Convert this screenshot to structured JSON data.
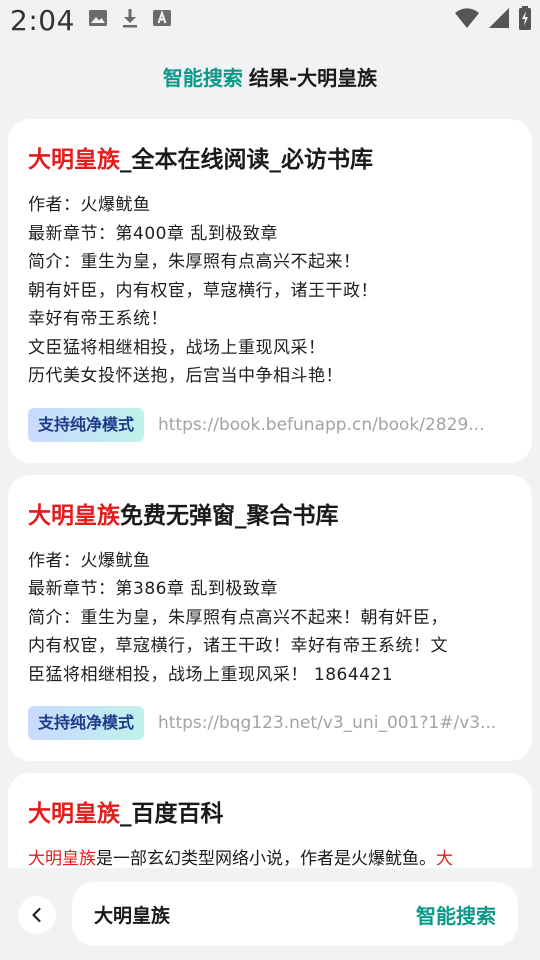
{
  "status_bar": {
    "time": "2:04",
    "left_icons": [
      "image-icon",
      "download-icon",
      "font-icon"
    ],
    "right_icons": [
      "wifi-icon",
      "signal-icon",
      "battery-charging-icon"
    ]
  },
  "header": {
    "brand": "智能搜索",
    "title": "结果-大明皇族"
  },
  "results": [
    {
      "title_highlight": "大明皇族",
      "title_rest": "_全本在线阅读_必访书库",
      "lines": [
        "作者：火爆鱿鱼",
        "最新章节：第400章 乱到极致章",
        "简介：重生为皇，朱厚照有点高兴不起来！",
        "朝有奸臣，内有权宦，草寇横行，诸王干政！",
        "幸好有帝王系统！",
        "文臣猛将相继相投，战场上重现风采！",
        "历代美女投怀送抱，后宫当中争相斗艳！"
      ],
      "badge": "支持纯净模式",
      "url": "https://book.befunapp.cn/book/2829..."
    },
    {
      "title_highlight": "大明皇族",
      "title_rest": "免费无弹窗_聚合书库",
      "lines": [
        "作者：火爆鱿鱼",
        "最新章节：第386章 乱到极致章",
        "简介：重生为皇，朱厚照有点高兴不起来！朝有奸臣，",
        "内有权宦，草寇横行，诸王干政！幸好有帝王系统！文",
        "臣猛将相继相投，战场上重现风采！ 1864421"
      ],
      "badge": "支持纯净模式",
      "url": "https://bqg123.net/v3_uni_001?1#/v3..."
    },
    {
      "title_highlight": "大明皇族",
      "title_rest": "_百度百科",
      "snippet_highlight": "大明皇族",
      "snippet_rest": "是一部玄幻类型网络小说，作者是火爆鱿鱼。",
      "snippet_tail": "大"
    }
  ],
  "search_bar": {
    "query": "大明皇族",
    "button_label": "智能搜索"
  },
  "colors": {
    "accent": "#0b9a8a",
    "highlight": "#e31c1c",
    "badge_text": "#1e3a8a",
    "url_text": "#a0a3a8"
  }
}
